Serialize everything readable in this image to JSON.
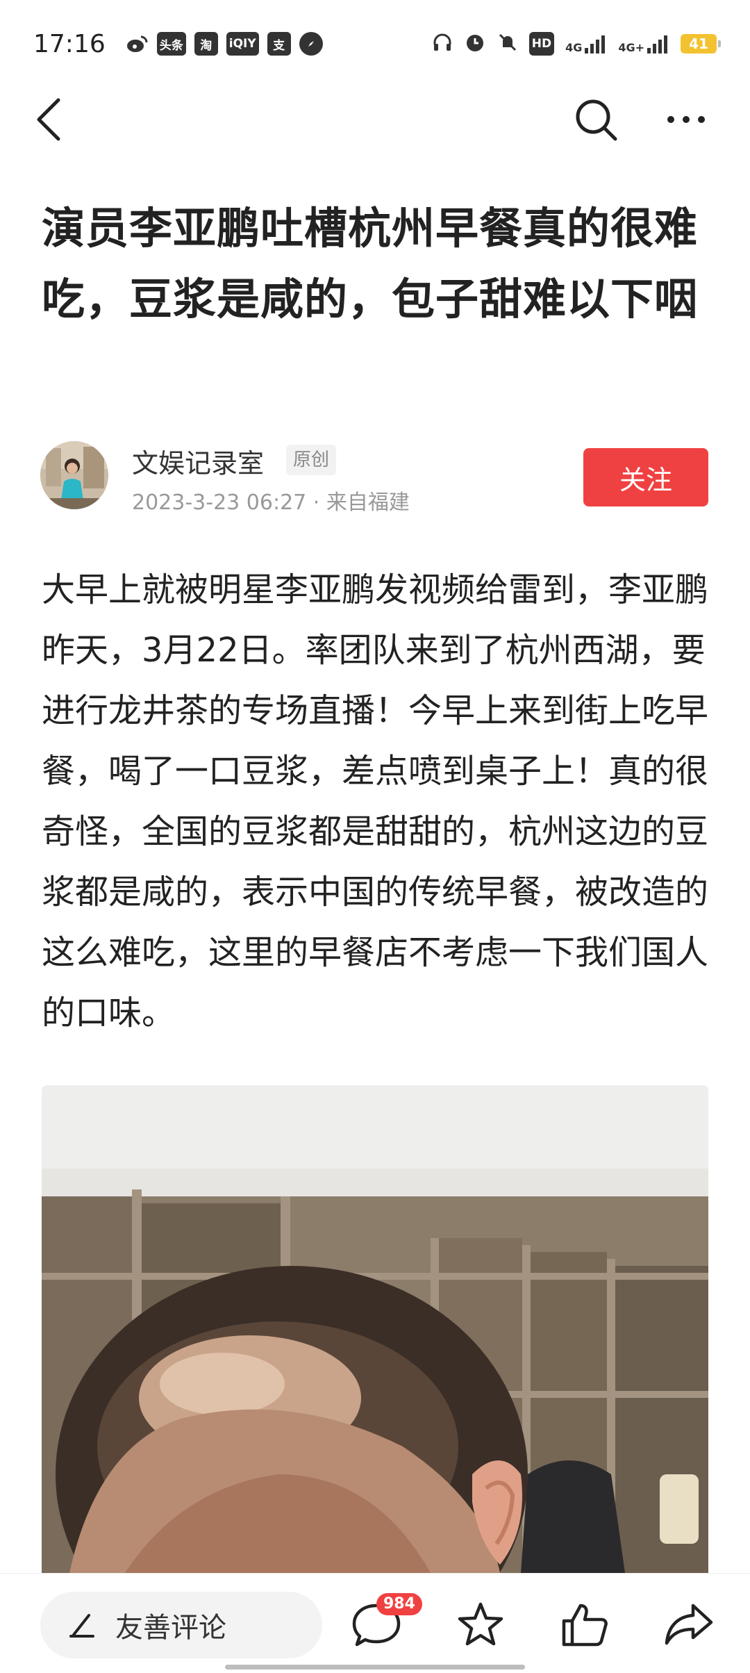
{
  "status_bar": {
    "time": "17:16",
    "left_icons": [
      "weibo-icon",
      "toutiao-icon",
      "taobao-icon",
      "iqiyi-icon",
      "alipay-icon",
      "compass-icon"
    ],
    "left_icon_labels": {
      "toutiao": "头条",
      "taobao": "淘",
      "iqiyi": "iQIY",
      "alipay": "支"
    },
    "right_icons": [
      "headphone-icon",
      "alarm-icon",
      "mute-icon",
      "hd-icon",
      "signal-4g-icon",
      "signal-4g-plus-icon",
      "battery-icon"
    ],
    "hd_label": "HD",
    "net1": "4G",
    "net2": "4G+",
    "battery_level": "41"
  },
  "nav": {
    "icons": [
      "back-icon",
      "search-icon",
      "more-icon"
    ]
  },
  "article": {
    "title": "演员李亚鹏吐槽杭州早餐真的很难吃，豆浆是咸的，包子甜难以下咽",
    "author": {
      "name": "文娱记录室",
      "badge": "原创",
      "meta": "2023-3-23 06:27 · 来自福建",
      "follow_label": "关注"
    },
    "body": "大早上就被明星李亚鹏发视频给雷到，李亚鹏昨天，3月22日。率团队来到了杭州西湖，要进行龙井茶的专场直播！今早上来到街上吃早餐，喝了一口豆浆，差点喷到桌子上！真的很奇怪，全国的豆浆都是甜甜的，杭州这边的豆浆都是咸的，表示中国的传统早餐，被改造的这么难吃，这里的早餐店不考虑一下我们国人的口味。"
  },
  "bottom_bar": {
    "comment_placeholder": "友善评论",
    "comment_count": "984",
    "icons": [
      "pen-icon",
      "comment-icon",
      "star-icon",
      "like-icon",
      "share-icon"
    ]
  },
  "colors": {
    "accent": "#f04142",
    "text": "#222222",
    "meta": "#999999"
  }
}
